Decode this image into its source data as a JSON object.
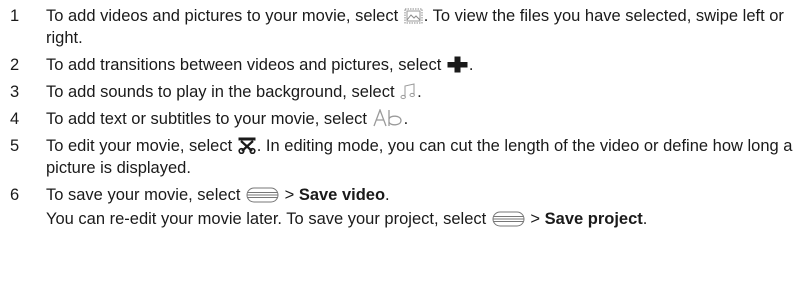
{
  "steps": [
    {
      "num": "1",
      "pre": "To add videos and pictures to your movie, select",
      "icon": "picture-icon",
      "post": ". To view the files you have selected, swipe left or right."
    },
    {
      "num": "2",
      "pre": "To add transitions between videos and pictures, select",
      "icon": "plus-icon",
      "post": "."
    },
    {
      "num": "3",
      "pre": "To add sounds to play in the background, select",
      "icon": "music-note-icon",
      "post": "."
    },
    {
      "num": "4",
      "pre": "To add text or subtitles to your movie, select",
      "icon": "text-ab-icon",
      "post": "."
    },
    {
      "num": "5",
      "pre": "To edit your movie, select",
      "icon": "scissors-icon",
      "post": ". In editing mode, you can cut the length of the video or define how long a picture is displayed."
    },
    {
      "num": "6",
      "pre": "To save your movie, select",
      "icon": "menu-icon",
      "sep": " > ",
      "bold": "Save video",
      "post": ".",
      "note_pre": "You can re-edit your movie later. To save your project, select",
      "note_icon": "menu-icon",
      "note_sep": " > ",
      "note_bold": "Save project",
      "note_post": "."
    }
  ]
}
